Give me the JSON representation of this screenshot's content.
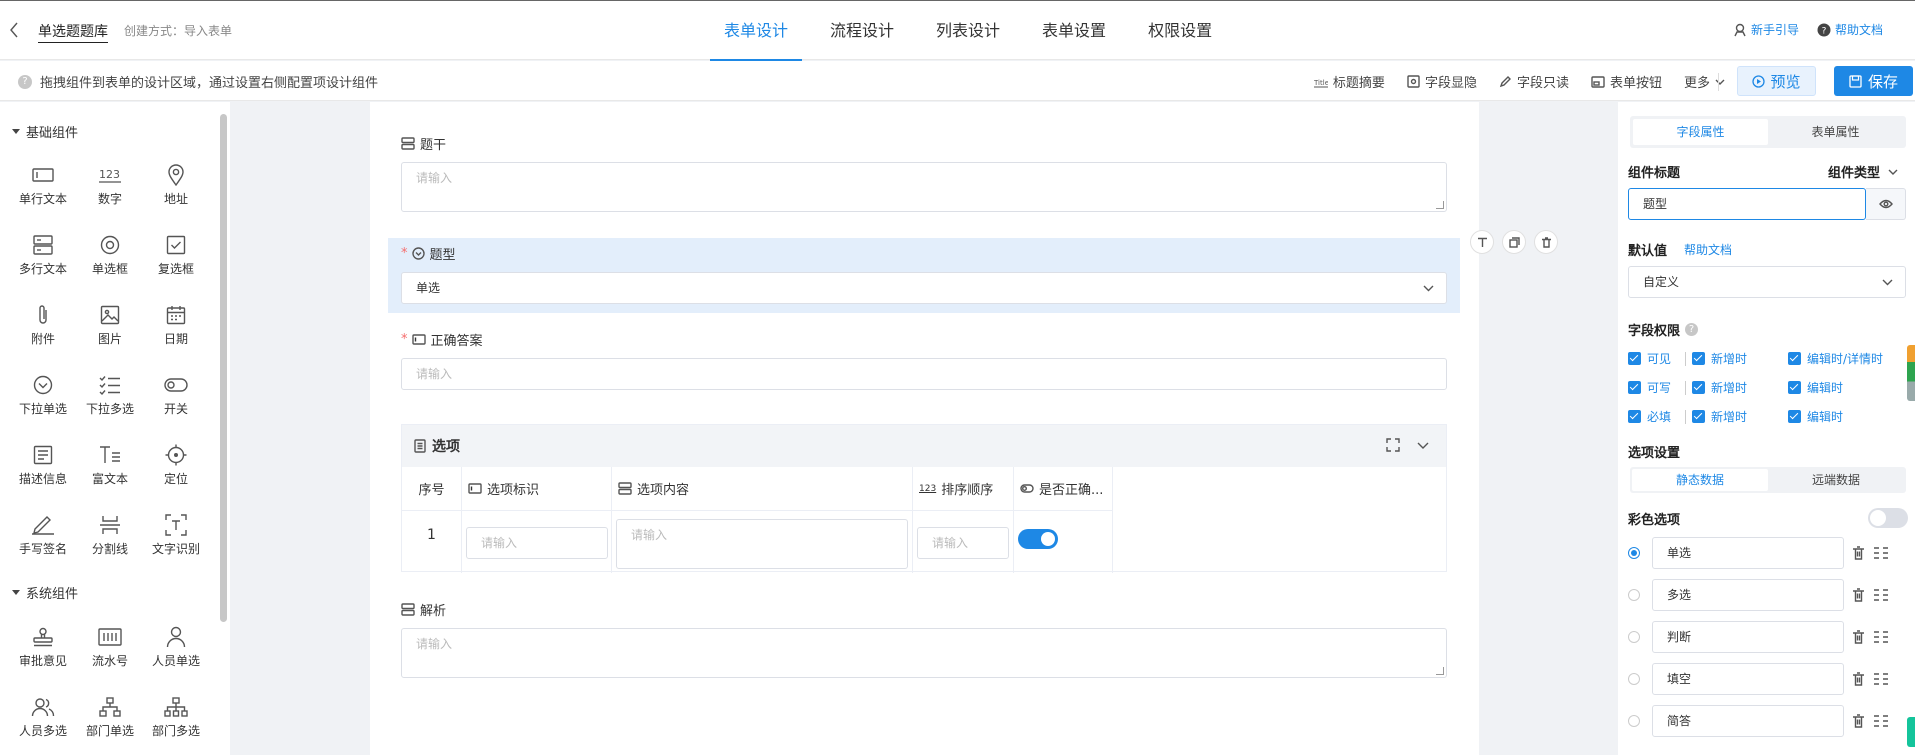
{
  "header": {
    "title": "单选题题库",
    "create_mode": "创建方式：导入表单",
    "tabs": [
      "表单设计",
      "流程设计",
      "列表设计",
      "表单设置",
      "权限设置"
    ],
    "active_tab": 0,
    "guide": "新手引导",
    "help": "帮助文档"
  },
  "toolbar": {
    "hint": "拖拽组件到表单的设计区域，通过设置右侧配置项设计组件",
    "actions": [
      "标题摘要",
      "字段显隐",
      "字段只读",
      "表单按钮",
      "更多"
    ],
    "preview": "预览",
    "save": "保存"
  },
  "left": {
    "group_basic": "基础组件",
    "basic": [
      {
        "label": "单行文本",
        "icon": "single-line-text-icon"
      },
      {
        "label": "数字",
        "icon": "number-icon"
      },
      {
        "label": "地址",
        "icon": "location-pin-icon"
      },
      {
        "label": "多行文本",
        "icon": "multi-line-text-icon"
      },
      {
        "label": "单选框",
        "icon": "radio-icon"
      },
      {
        "label": "复选框",
        "icon": "checkbox-icon"
      },
      {
        "label": "附件",
        "icon": "paperclip-icon"
      },
      {
        "label": "图片",
        "icon": "image-icon"
      },
      {
        "label": "日期",
        "icon": "calendar-icon"
      },
      {
        "label": "下拉单选",
        "icon": "dropdown-single-icon"
      },
      {
        "label": "下拉多选",
        "icon": "dropdown-multi-icon"
      },
      {
        "label": "开关",
        "icon": "switch-icon"
      },
      {
        "label": "描述信息",
        "icon": "description-icon"
      },
      {
        "label": "富文本",
        "icon": "rich-text-icon"
      },
      {
        "label": "定位",
        "icon": "crosshair-icon"
      },
      {
        "label": "手写签名",
        "icon": "signature-icon"
      },
      {
        "label": "分割线",
        "icon": "divider-icon"
      },
      {
        "label": "文字识别",
        "icon": "ocr-icon"
      }
    ],
    "group_system": "系统组件",
    "system": [
      {
        "label": "审批意见",
        "icon": "stamp-icon"
      },
      {
        "label": "流水号",
        "icon": "serial-number-icon"
      },
      {
        "label": "人员单选",
        "icon": "user-icon"
      },
      {
        "label": "人员多选",
        "icon": "users-icon"
      },
      {
        "label": "部门单选",
        "icon": "org-icon"
      },
      {
        "label": "部门多选",
        "icon": "org-multi-icon"
      }
    ]
  },
  "canvas": {
    "stem_label": "题干",
    "stem_placeholder": "请输入",
    "type_label": "题型",
    "type_value": "单选",
    "answer_label": "正确答案",
    "answer_placeholder": "请输入",
    "options_title": "选项",
    "columns": [
      "序号",
      "选项标识",
      "选项内容",
      "排序顺序",
      "是否正确..."
    ],
    "row_index": "1",
    "cell_placeholder": "请输入",
    "analysis_label": "解析",
    "analysis_placeholder": "请输入"
  },
  "right": {
    "tab_field": "字段属性",
    "tab_form": "表单属性",
    "component_title_label": "组件标题",
    "component_type_label": "组件类型",
    "title_value": "题型",
    "default_label": "默认值",
    "help_doc": "帮助文档",
    "default_value": "自定义",
    "perm_label": "字段权限",
    "perm_rows": [
      {
        "a": "可见",
        "b": "新增时",
        "c": "编辑时/详情时"
      },
      {
        "a": "可写",
        "b": "新增时",
        "c": "编辑时"
      },
      {
        "a": "必填",
        "b": "新增时",
        "c": "编辑时"
      }
    ],
    "option_settings_label": "选项设置",
    "static_data": "静态数据",
    "remote_data": "远端数据",
    "color_option_label": "彩色选项",
    "options": [
      "单选",
      "多选",
      "判断",
      "填空",
      "简答"
    ],
    "selected_option": 0
  },
  "colors": {
    "accent": "#1e88e5",
    "selected_bg": "#e3eefb",
    "required": "#f56c6c"
  }
}
